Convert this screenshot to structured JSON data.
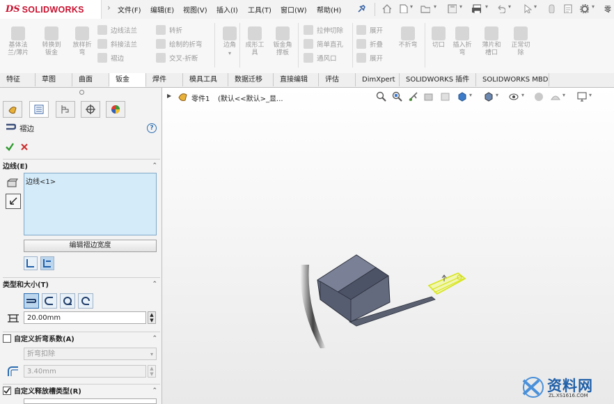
{
  "app": {
    "logo_ds": "DS",
    "logo_name": "SOLIDWORKS"
  },
  "menu": [
    "文件(F)",
    "编辑(E)",
    "视图(V)",
    "插入(I)",
    "工具(T)",
    "窗口(W)",
    "帮助(H)"
  ],
  "title_truncated": "零",
  "ribbon": {
    "col1": [
      "基体法",
      "兰/薄片"
    ],
    "col2": [
      "转换到",
      "钣金"
    ],
    "col3": [
      "放样折",
      "弯"
    ],
    "small1": [
      "边线法兰",
      "斜接法兰",
      "褶边"
    ],
    "small2": [
      "转折",
      "绘制的折弯",
      "交叉-折断"
    ],
    "col_edge": [
      "边角"
    ],
    "col_form": [
      "成形工",
      "具"
    ],
    "col_gusset": [
      "钣金角",
      "撑板"
    ],
    "small3": [
      "拉伸切除",
      "简单直孔",
      "通风口"
    ],
    "small4": [
      "展开",
      "折叠",
      "展开"
    ],
    "col_nofold": [
      "不折弯"
    ],
    "col_cut": [
      "切口"
    ],
    "col_insert": [
      "插入折",
      "弯"
    ],
    "col_rip": [
      "薄片和",
      "槽口"
    ],
    "col_normal": [
      "正常切",
      "除"
    ]
  },
  "tabs": [
    "特征",
    "草图",
    "曲面",
    "钣金",
    "焊件",
    "模具工具",
    "数据迁移",
    "直接编辑",
    "评估",
    "DimXpert",
    "SOLIDWORKS 插件",
    "SOLIDWORKS MBD"
  ],
  "active_tab": "钣金",
  "feature_tree": {
    "part": "零件1",
    "config": "(默认<<默认>_显..."
  },
  "property_manager": {
    "title": "褶边",
    "help": "?",
    "edges_section": "边线(E)",
    "edges_list": [
      "边线<1>"
    ],
    "edit_width_button": "编辑褶边宽度",
    "type_section": "类型和大小(T)",
    "length_value": "20.00mm",
    "custom_bend": {
      "label": "自定义折弯系数(A)",
      "checked": false,
      "option": "折弯扣除",
      "value": "3.40mm"
    },
    "custom_relief": {
      "label": "自定义释放槽类型(R)",
      "checked": true
    }
  },
  "watermark": {
    "name": "资料网",
    "url": "ZL.XS1616.COM"
  },
  "colors": {
    "accent_blue": "#2b6cb0",
    "selection_yellow": "#f0ff3a",
    "part_gray": "#5c6172",
    "list_bg": "#d4ebf9",
    "logo_red": "#c8102e"
  }
}
